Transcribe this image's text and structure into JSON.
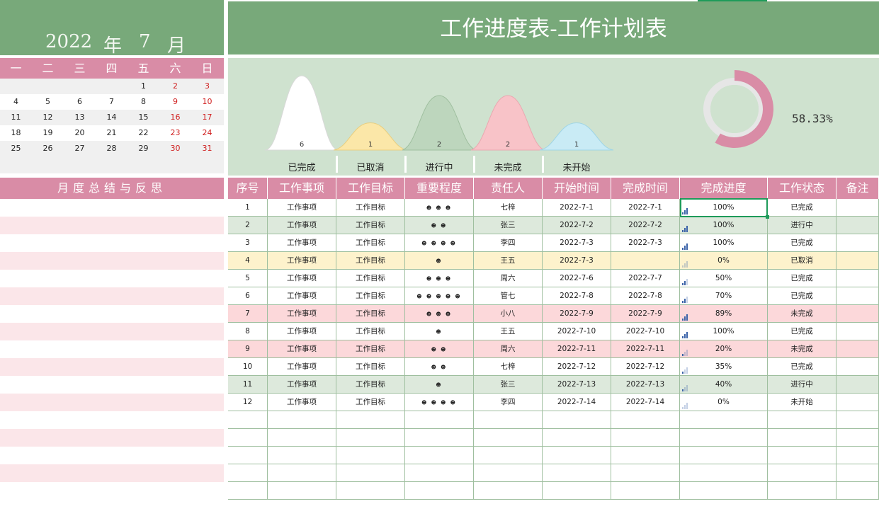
{
  "calendar": {
    "year": "2022",
    "year_unit": "年",
    "month": "7",
    "month_unit": "月",
    "weekdays": [
      "一",
      "二",
      "三",
      "四",
      "五",
      "六",
      "日"
    ],
    "weeks": [
      [
        "",
        "",
        "",
        "",
        "1",
        "2",
        "3"
      ],
      [
        "4",
        "5",
        "6",
        "7",
        "8",
        "9",
        "10"
      ],
      [
        "11",
        "12",
        "13",
        "14",
        "15",
        "16",
        "17"
      ],
      [
        "18",
        "19",
        "20",
        "21",
        "22",
        "23",
        "24"
      ],
      [
        "25",
        "26",
        "27",
        "28",
        "29",
        "30",
        "31"
      ]
    ]
  },
  "summary": {
    "title": "月度总结与反思"
  },
  "header": {
    "title": "工作进度表-工作计划表"
  },
  "chart_data": {
    "type": "area",
    "categories": [
      "已完成",
      "已取消",
      "进行中",
      "未完成",
      "未开始"
    ],
    "values": [
      6,
      1,
      2,
      2,
      1
    ],
    "colors": [
      "#ffffff",
      "#fbe7a8",
      "#bdd6bd",
      "#f8c3c8",
      "#c9ebf5"
    ],
    "donut": {
      "value": 58.33,
      "label": "58.33%",
      "fill_color": "#d98ca6",
      "track_color": "#e6e6e6"
    }
  },
  "table": {
    "columns": [
      "序号",
      "工作事项",
      "工作目标",
      "重要程度",
      "责任人",
      "开始时间",
      "完成时间",
      "完成进度",
      "工作状态",
      "备注"
    ],
    "rows": [
      {
        "no": "1",
        "item": "工作事项",
        "goal": "工作目标",
        "importance": "☻ ☻ ☻",
        "owner": "七梓",
        "start": "2022-7-1",
        "end": "2022-7-1",
        "progress": "100%",
        "progress_value": 1.0,
        "status": "已完成",
        "note": "",
        "tone": "white"
      },
      {
        "no": "2",
        "item": "工作事项",
        "goal": "工作目标",
        "importance": "☻ ☻",
        "owner": "张三",
        "start": "2022-7-2",
        "end": "2022-7-2",
        "progress": "100%",
        "progress_value": 1.0,
        "status": "进行中",
        "note": "",
        "tone": "green"
      },
      {
        "no": "3",
        "item": "工作事项",
        "goal": "工作目标",
        "importance": "☻ ☻ ☻ ☻",
        "owner": "李四",
        "start": "2022-7-3",
        "end": "2022-7-3",
        "progress": "100%",
        "progress_value": 1.0,
        "status": "已完成",
        "note": "",
        "tone": "white"
      },
      {
        "no": "4",
        "item": "工作事项",
        "goal": "工作目标",
        "importance": "☻",
        "owner": "王五",
        "start": "2022-7-3",
        "end": "",
        "progress": "0%",
        "progress_value": 0.0,
        "status": "已取消",
        "note": "",
        "tone": "yellow"
      },
      {
        "no": "5",
        "item": "工作事项",
        "goal": "工作目标",
        "importance": "☻ ☻ ☻",
        "owner": "周六",
        "start": "2022-7-6",
        "end": "2022-7-7",
        "progress": "50%",
        "progress_value": 0.5,
        "status": "已完成",
        "note": "",
        "tone": "white"
      },
      {
        "no": "6",
        "item": "工作事项",
        "goal": "工作目标",
        "importance": "☻ ☻ ☻ ☻ ☻",
        "owner": "管七",
        "start": "2022-7-8",
        "end": "2022-7-8",
        "progress": "70%",
        "progress_value": 0.7,
        "status": "已完成",
        "note": "",
        "tone": "white"
      },
      {
        "no": "7",
        "item": "工作事项",
        "goal": "工作目标",
        "importance": "☻ ☻ ☻",
        "owner": "小八",
        "start": "2022-7-9",
        "end": "2022-7-9",
        "progress": "89%",
        "progress_value": 0.89,
        "status": "未完成",
        "note": "",
        "tone": "red"
      },
      {
        "no": "8",
        "item": "工作事项",
        "goal": "工作目标",
        "importance": "☻",
        "owner": "王五",
        "start": "2022-7-10",
        "end": "2022-7-10",
        "progress": "100%",
        "progress_value": 1.0,
        "status": "已完成",
        "note": "",
        "tone": "white"
      },
      {
        "no": "9",
        "item": "工作事项",
        "goal": "工作目标",
        "importance": "☻ ☻",
        "owner": "周六",
        "start": "2022-7-11",
        "end": "2022-7-11",
        "progress": "20%",
        "progress_value": 0.2,
        "status": "未完成",
        "note": "",
        "tone": "red"
      },
      {
        "no": "10",
        "item": "工作事项",
        "goal": "工作目标",
        "importance": "☻ ☻",
        "owner": "七梓",
        "start": "2022-7-12",
        "end": "2022-7-12",
        "progress": "35%",
        "progress_value": 0.35,
        "status": "已完成",
        "note": "",
        "tone": "white"
      },
      {
        "no": "11",
        "item": "工作事项",
        "goal": "工作目标",
        "importance": "☻",
        "owner": "张三",
        "start": "2022-7-13",
        "end": "2022-7-13",
        "progress": "40%",
        "progress_value": 0.4,
        "status": "进行中",
        "note": "",
        "tone": "green"
      },
      {
        "no": "12",
        "item": "工作事项",
        "goal": "工作目标",
        "importance": "☻ ☻ ☻ ☻",
        "owner": "李四",
        "start": "2022-7-14",
        "end": "2022-7-14",
        "progress": "0%",
        "progress_value": 0.0,
        "status": "未开始",
        "note": "",
        "tone": "white"
      }
    ],
    "empty_rows": 6
  }
}
